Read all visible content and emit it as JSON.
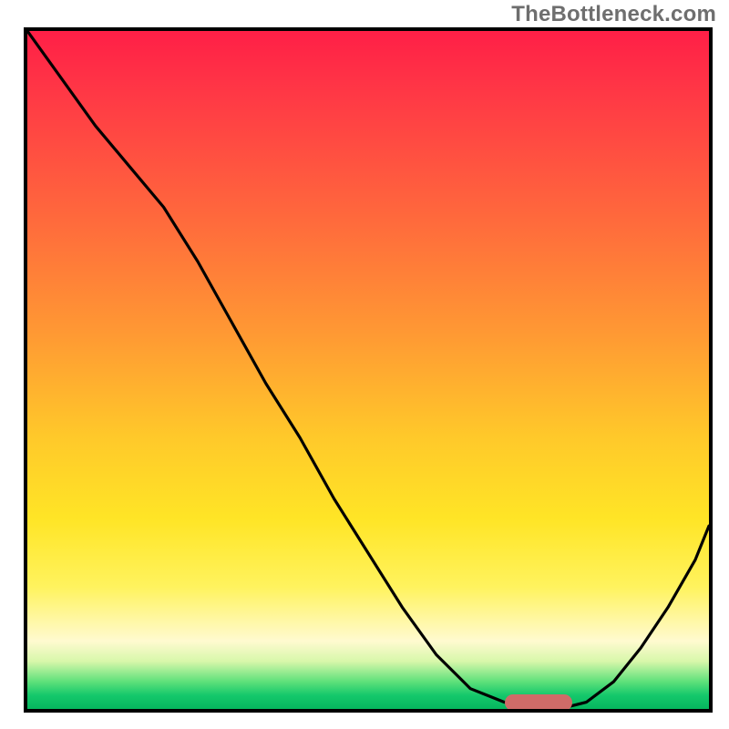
{
  "watermark": "TheBottleneck.com",
  "chart_data": {
    "type": "line",
    "title": "",
    "xlabel": "",
    "ylabel": "",
    "xlim": [
      0,
      100
    ],
    "ylim": [
      0,
      100
    ],
    "x": [
      0,
      5,
      10,
      15,
      20,
      25,
      30,
      35,
      40,
      45,
      50,
      55,
      60,
      65,
      70,
      74,
      78,
      82,
      86,
      90,
      94,
      98,
      100
    ],
    "values": [
      100,
      93,
      86,
      80,
      74,
      66,
      57,
      48,
      40,
      31,
      23,
      15,
      8,
      3,
      1,
      0,
      0,
      1,
      4,
      9,
      15,
      22,
      27
    ],
    "marker": {
      "x_start": 70,
      "x_end": 80,
      "y": 1
    },
    "gradient_stops": [
      {
        "pos": 0,
        "color": "#ff1f47"
      },
      {
        "pos": 28,
        "color": "#ff6a3c"
      },
      {
        "pos": 60,
        "color": "#ffc92a"
      },
      {
        "pos": 82,
        "color": "#fff35e"
      },
      {
        "pos": 96,
        "color": "#5de07a"
      },
      {
        "pos": 100,
        "color": "#06b65e"
      }
    ]
  }
}
